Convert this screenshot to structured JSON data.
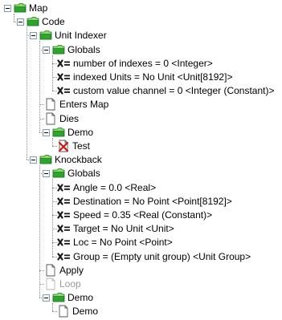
{
  "tree": {
    "nodes": [
      {
        "label": "Map",
        "type": "folder",
        "depth": 0,
        "expanded": true
      },
      {
        "label": "Code",
        "type": "folder",
        "depth": 1,
        "expanded": true
      },
      {
        "label": "Unit Indexer",
        "type": "folder",
        "depth": 2,
        "expanded": true
      },
      {
        "label": "Globals",
        "type": "folder",
        "depth": 3,
        "expanded": true
      },
      {
        "label": "number of indexes = 0 <Integer>",
        "type": "variable",
        "depth": 4
      },
      {
        "label": "indexed Units = No Unit <Unit[8192]>",
        "type": "variable",
        "depth": 4
      },
      {
        "label": "custom value channel = 0 <Integer (Constant)>",
        "type": "variable",
        "depth": 4
      },
      {
        "label": "Enters Map",
        "type": "trigger",
        "depth": 3
      },
      {
        "label": "Dies",
        "type": "trigger",
        "depth": 3
      },
      {
        "label": "Demo",
        "type": "folder",
        "depth": 3,
        "expanded": true
      },
      {
        "label": "Test",
        "type": "trigger-error",
        "depth": 4
      },
      {
        "label": "Knockback",
        "type": "folder",
        "depth": 2,
        "expanded": true
      },
      {
        "label": "Globals",
        "type": "folder",
        "depth": 3,
        "expanded": true
      },
      {
        "label": "Angle = 0.0 <Real>",
        "type": "variable",
        "depth": 4
      },
      {
        "label": "Destination = No Point <Point[8192]>",
        "type": "variable",
        "depth": 4
      },
      {
        "label": "Speed = 0.35 <Real (Constant)>",
        "type": "variable",
        "depth": 4
      },
      {
        "label": "Target = No Unit <Unit>",
        "type": "variable",
        "depth": 4
      },
      {
        "label": "Loc = No Point <Point>",
        "type": "variable",
        "depth": 4
      },
      {
        "label": "Group = (Empty unit group) <Unit Group>",
        "type": "variable",
        "depth": 4
      },
      {
        "label": "Apply",
        "type": "trigger",
        "depth": 3
      },
      {
        "label": "Loop",
        "type": "trigger-disabled",
        "depth": 3
      },
      {
        "label": "Demo",
        "type": "folder",
        "depth": 3,
        "expanded": true
      },
      {
        "label": "Demo",
        "type": "trigger",
        "depth": 4
      }
    ]
  },
  "colors": {
    "folder_green": "#2fa32f",
    "folder_green_light": "#8ddd6a",
    "variable_icon": "#1a1a1a",
    "trigger_page": "#ffffff",
    "error_red": "#d21414",
    "disabled_text": "#9a9a9a",
    "tree_lines": "#8c8c8c"
  },
  "icons": {
    "folder": "green-folder-icon",
    "variable": "variable-x-equals-icon",
    "trigger": "trigger-page-icon",
    "trigger-error": "trigger-error-icon",
    "trigger-disabled": "trigger-disabled-icon"
  }
}
